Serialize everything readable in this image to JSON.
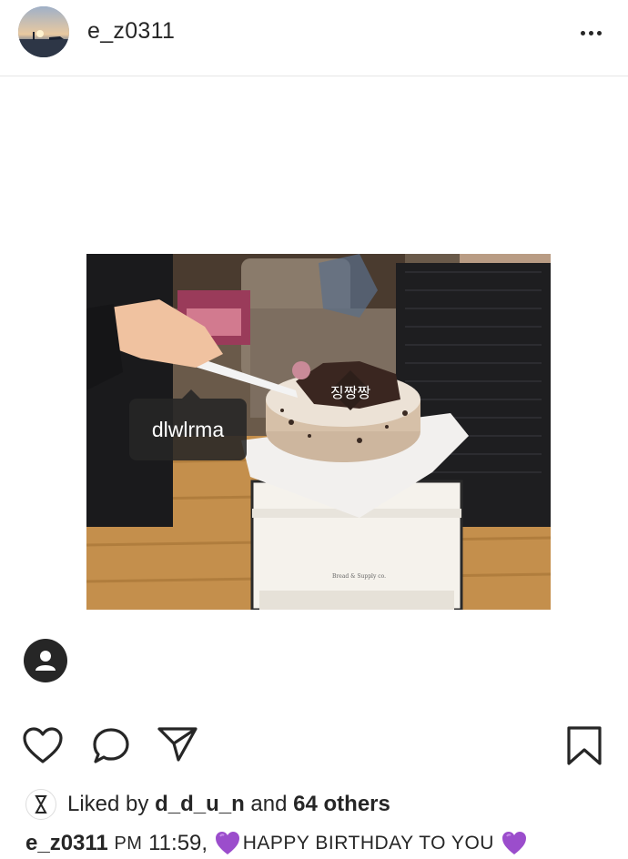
{
  "post": {
    "username": "e_z0311",
    "tag_label": "dlwlrma"
  },
  "likes": {
    "prefix": "Liked by",
    "liker": "d_d_u_n",
    "middle": "and",
    "others": "64 others"
  },
  "caption": {
    "username": "e_z0311",
    "time_period": "PM",
    "time": "11:59,",
    "text": "HAPPY BIRTHDAY TO YOU"
  },
  "icons": {
    "more": "more-dots-icon",
    "like": "heart-icon",
    "comment": "comment-icon",
    "share": "paper-plane-icon",
    "save": "bookmark-icon",
    "tagged_user": "person-icon",
    "emoji": "purple-heart-icon"
  },
  "colors": {
    "text": "#262626",
    "purple_heart": "#9b4dcc"
  }
}
